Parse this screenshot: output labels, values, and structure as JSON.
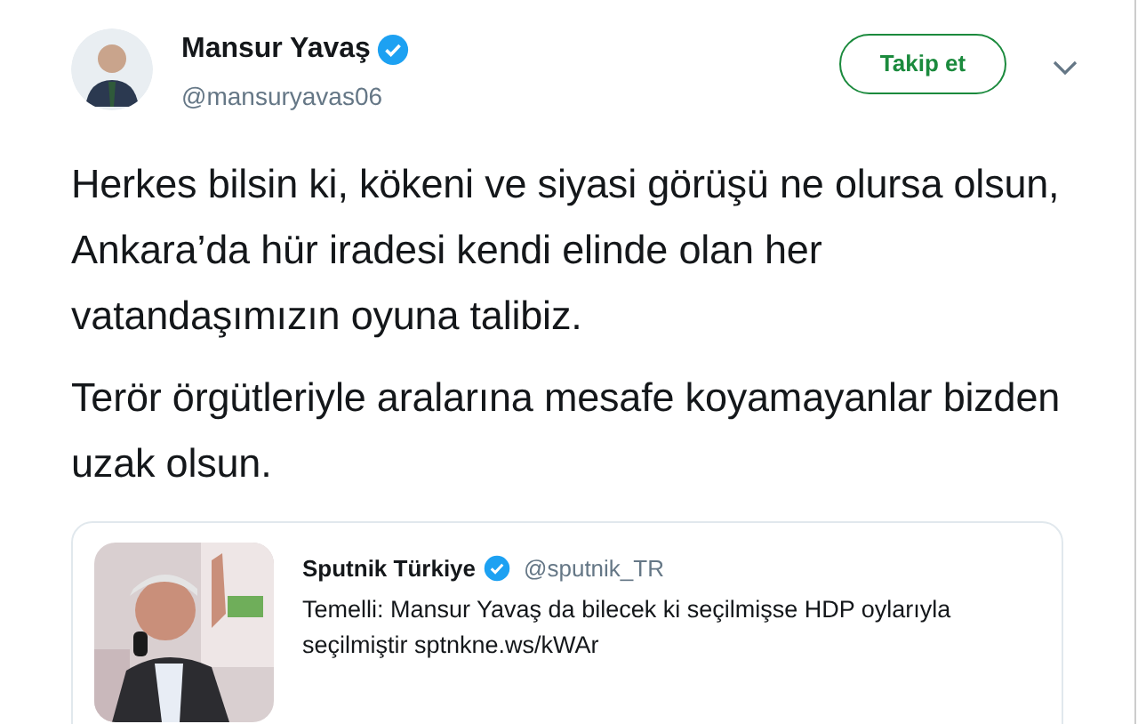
{
  "author": {
    "name": "Mansur Yavaş",
    "verified": true,
    "handle": "@mansuryavas06"
  },
  "follow_button": {
    "label": "Takip et"
  },
  "tweet_paragraphs": [
    "Herkes bilsin ki, kökeni ve siyasi görüşü ne olursa olsun, Ankara’da hür iradesi kendi elinde olan her vatandaşımızın oyuna talibiz.",
    "Terör örgütleriyle aralarına mesafe koyamayanlar bizden uzak olsun."
  ],
  "quoted_tweet": {
    "name": "Sputnik Türkiye",
    "verified": true,
    "handle": "@sputnik_TR",
    "text": "Temelli: Mansur Yavaş da bilecek ki seçilmişse HDP oylarıyla seçilmiştir sptnkne.ws/kWAr"
  }
}
